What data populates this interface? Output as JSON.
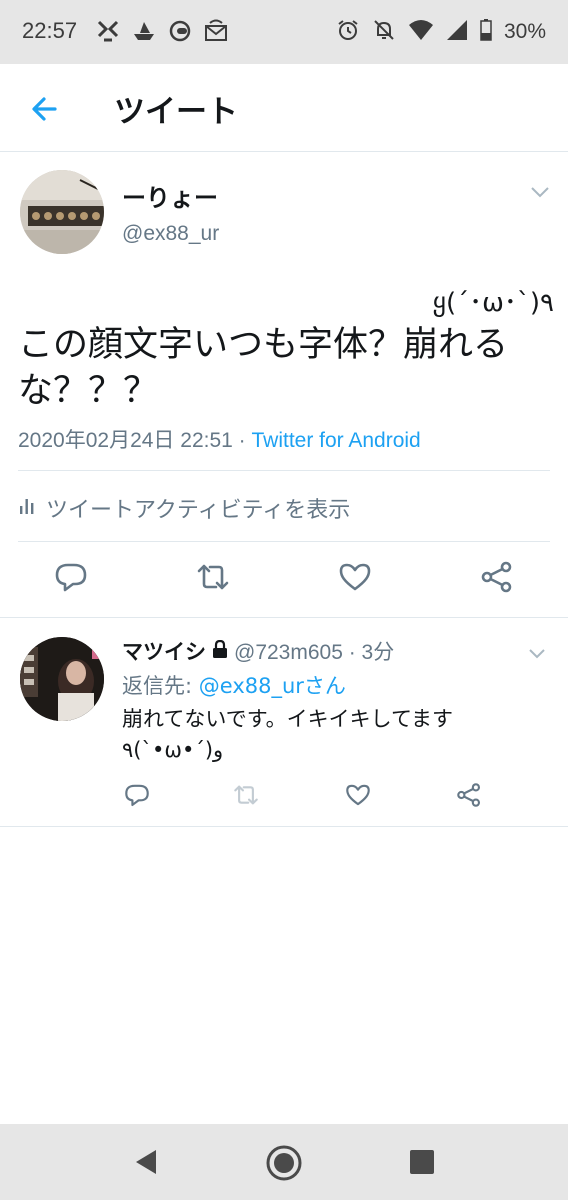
{
  "status_bar": {
    "time": "22:57",
    "battery": "30%",
    "icons": [
      "nfc-icon",
      "ship-icon",
      "android-head-icon",
      "mail-icon",
      "alarm-icon",
      "bell-off-icon",
      "wifi-icon",
      "signal-icon",
      "battery-icon"
    ]
  },
  "header": {
    "title": "ツイート",
    "back_icon": "back-arrow-icon"
  },
  "tweet": {
    "display_name": "ーりょー",
    "handle": "@ex88_ur",
    "kaomoji": "ყ(´･ω･`)٩",
    "text": "この顔文字いつも字体？崩れるな？？？",
    "timestamp": "2020年02月24日 22:51 · ",
    "source": "Twitter for Android",
    "activity_label": "ツイートアクティビティを表示",
    "actions": [
      "reply-icon",
      "retweet-icon",
      "like-icon",
      "share-icon"
    ]
  },
  "reply": {
    "display_name": "マツイシ",
    "handle_time": "@723m605 · 3分",
    "reply_prefix": "返信先: ",
    "reply_mention": "@ex88_urさん",
    "text": "崩れてないです。イキイキしてます",
    "kaomoji": "٩(`•ω•´)ﻭ"
  },
  "colors": {
    "accent": "#1da1f2",
    "muted": "#657786",
    "text": "#14171a",
    "divider": "#e1e8ed"
  }
}
